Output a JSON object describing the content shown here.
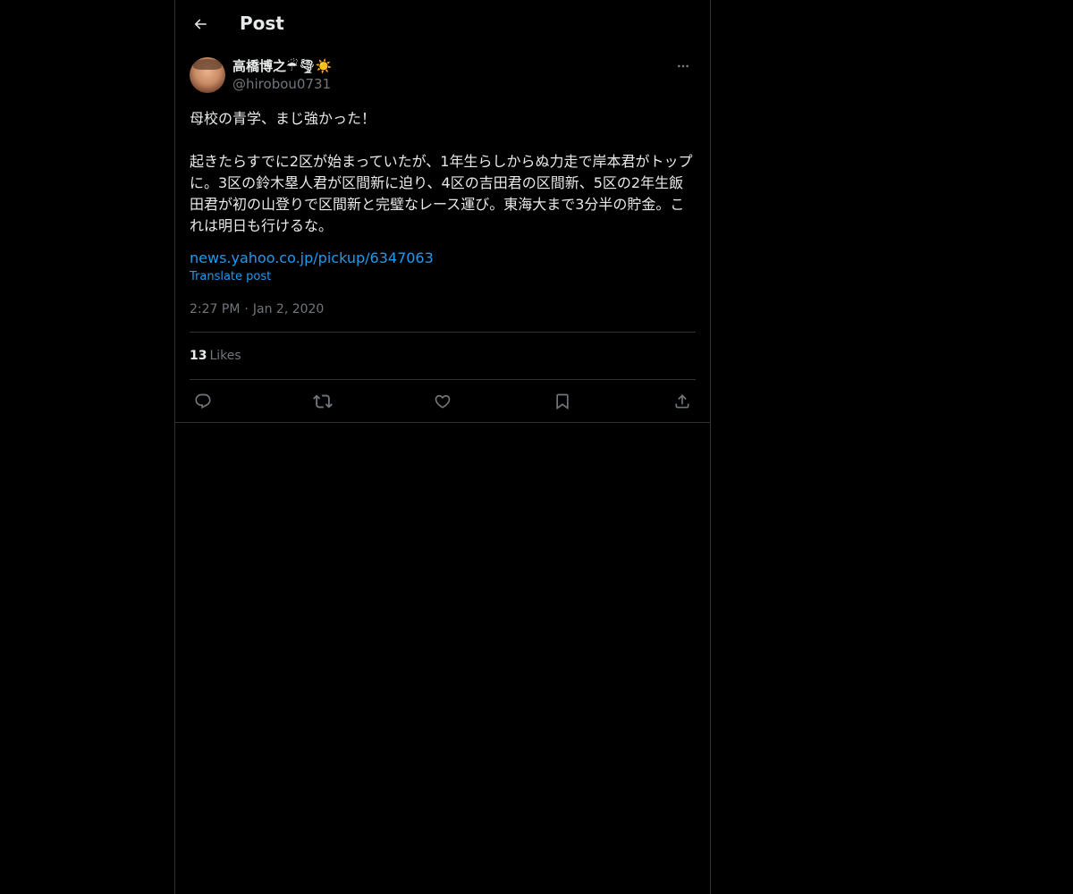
{
  "header": {
    "title": "Post"
  },
  "post": {
    "author": {
      "display_name": "高橋博之☔🌪☀️",
      "handle": "@hirobou0731"
    },
    "text": "母校の青学、まじ強かった！\n\n起きたらすでに2区が始まっていたが、1年生らしからぬ力走で岸本君がトップに。3区の鈴木塁人君が区間新に迫り、4区の吉田君の区間新、5区の2年生飯田君が初の山登りで区間新と完璧なレース運び。東海大まで3分半の貯金。これは明日も行けるな。",
    "link": "news.yahoo.co.jp/pickup/6347063",
    "translate_label": "Translate post",
    "time": "2:27 PM",
    "date": "Jan 2, 2020",
    "likes_count": "13",
    "likes_label": "Likes"
  },
  "icons": {
    "back": "arrow-left-icon",
    "more": "more-horizontal-icon",
    "reply": "reply-icon",
    "repost": "repost-icon",
    "like": "heart-icon",
    "bookmark": "bookmark-icon",
    "share": "share-icon"
  },
  "colors": {
    "background": "#000000",
    "text": "#e7e9ea",
    "secondary_text": "#71767b",
    "link": "#1d9bf0",
    "divider": "#2f3336"
  }
}
